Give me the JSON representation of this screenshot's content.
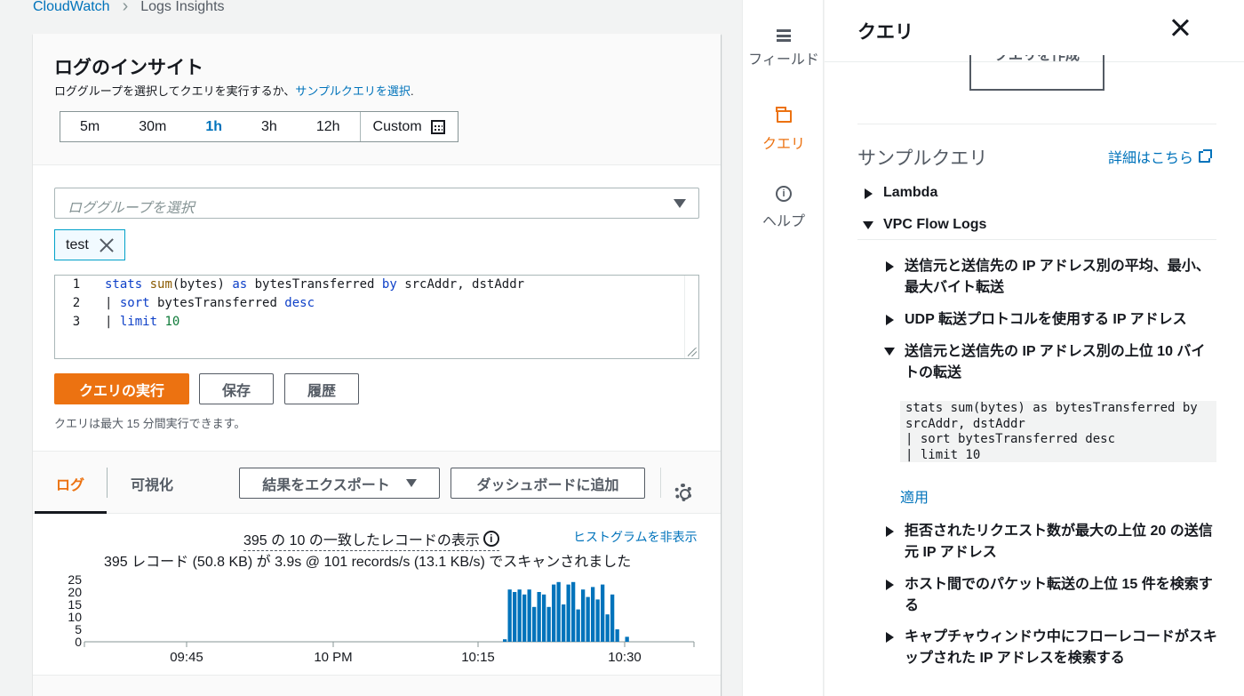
{
  "breadcrumb": {
    "root": "CloudWatch",
    "current": "Logs Insights"
  },
  "header": {
    "title": "ログのインサイト",
    "subtitle_prefix": "ロググループを選択してクエリを実行するか、",
    "subtitle_link": "サンプルクエリを選択",
    "subtitle_suffix": "."
  },
  "time_range": {
    "options": [
      "5m",
      "30m",
      "1h",
      "3h",
      "12h"
    ],
    "selected": "1h",
    "custom_label": "Custom"
  },
  "log_group": {
    "placeholder": "ロググループを選択",
    "selected_token": "test"
  },
  "editor": {
    "line_numbers": [
      "1",
      "2",
      "3"
    ],
    "lines": [
      [
        [
          "kw",
          "stats"
        ],
        [
          "txt",
          " "
        ],
        [
          "fn",
          "sum"
        ],
        [
          "txt",
          "(bytes) "
        ],
        [
          "kw",
          "as"
        ],
        [
          "txt",
          " bytesTransferred "
        ],
        [
          "kw",
          "by"
        ],
        [
          "txt",
          " srcAddr, dstAddr"
        ]
      ],
      [
        [
          "txt",
          "| "
        ],
        [
          "kw",
          "sort"
        ],
        [
          "txt",
          " bytesTransferred "
        ],
        [
          "kw",
          "desc"
        ]
      ],
      [
        [
          "txt",
          "| "
        ],
        [
          "kw",
          "limit"
        ],
        [
          "txt",
          " "
        ],
        [
          "num",
          "10"
        ]
      ]
    ]
  },
  "actions": {
    "run": "クエリの実行",
    "save": "保存",
    "history": "履歴"
  },
  "note": "クエリは最大 15 分間実行できます。",
  "tabs": {
    "logs": "ログ",
    "visualize": "可視化"
  },
  "export_label": "結果をエクスポート",
  "dashboard_label": "ダッシュボードに追加",
  "results": {
    "title": "395 の 10 の一致したレコードの表示",
    "hide_histogram": "ヒストグラムを非表示",
    "scan_summary": "395 レコード (50.8 KB) が 3.9s @ 101 records/s (13.1 KB/s) でスキャンされました"
  },
  "chart_data": {
    "type": "bar",
    "y_ticks": [
      "25",
      "20",
      "15",
      "10",
      "5",
      "0"
    ],
    "ylim": [
      0,
      25
    ],
    "x_ticks": [
      "09:45",
      "10 PM",
      "10:15",
      "10:30"
    ],
    "values": [
      1,
      21,
      20,
      21,
      19,
      21,
      14,
      20,
      19,
      14,
      23,
      24,
      15,
      23,
      24,
      13,
      21,
      18,
      22,
      17,
      23,
      11,
      19,
      5,
      0,
      2
    ]
  },
  "sidebar_rail": {
    "fields": "フィールド",
    "queries": "クエリ",
    "help": "ヘルプ"
  },
  "panel": {
    "title": "クエリ",
    "create_button": "クエリを作成",
    "sample_title": "サンプルクエリ",
    "learn_more": "詳細はこちら",
    "categories": [
      {
        "label": "Lambda",
        "expanded": false
      },
      {
        "label": "VPC Flow Logs",
        "expanded": true
      }
    ],
    "vpc_queries": [
      "送信元と送信先の IP アドレス別の平均、最小、最大バイト転送",
      "UDP 転送プロトコルを使用する IP アドレス",
      "送信元と送信先の IP アドレス別の上位 10 バイトの転送",
      "拒否されたリクエスト数が最大の上位 20 の送信元 IP アドレス",
      "ホスト間でのパケット転送の上位 15 件を検索する",
      "キャプチャウィンドウ中にフローレコードがスキップされた IP アドレスを検索する"
    ],
    "expanded_query_code": "stats sum(bytes) as bytesTransferred by\nsrcAddr, dstAddr\n| sort bytesTransferred desc\n| limit 10",
    "apply": "適用"
  }
}
